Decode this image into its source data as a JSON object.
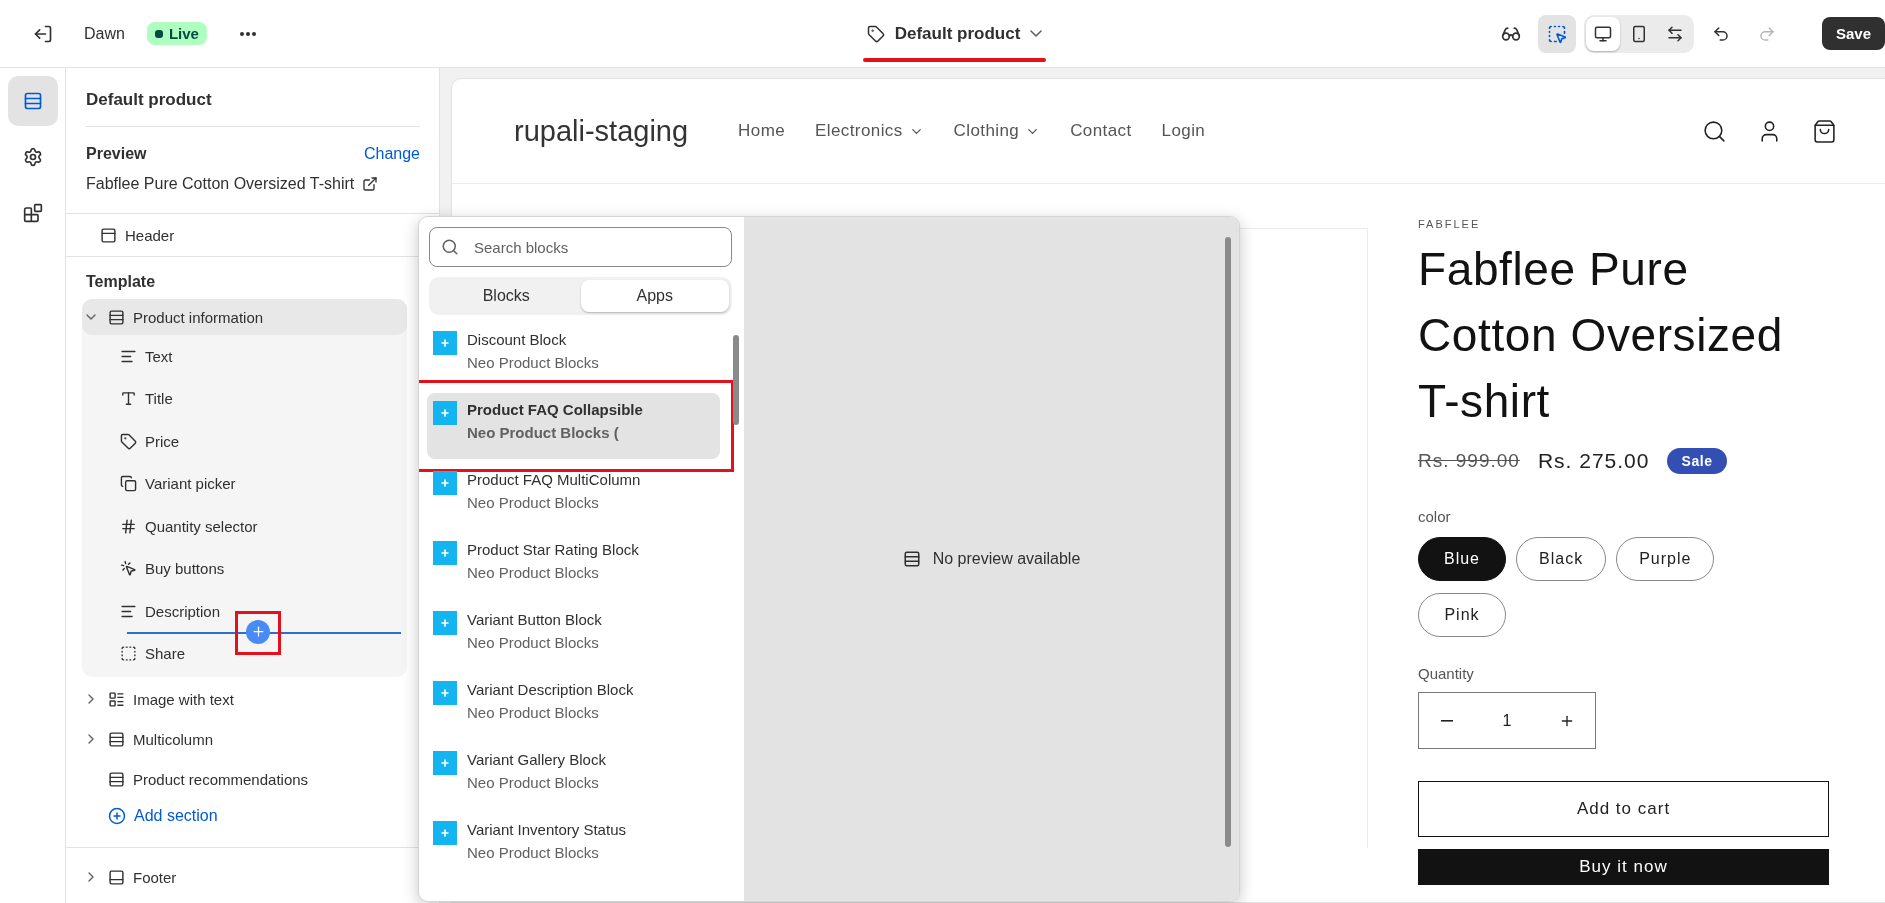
{
  "topbar": {
    "theme_name": "Dawn",
    "status_badge": "Live",
    "template_selector": "Default product",
    "save_button": "Save",
    "tools": [
      {
        "kind": "inspector",
        "selected": true
      }
    ],
    "views": [
      {
        "kind": "desktop",
        "selected": true
      },
      {
        "kind": "mobile",
        "selected": false
      },
      {
        "kind": "fullwidth",
        "selected": false
      }
    ]
  },
  "rail": [
    {
      "kind": "sections",
      "selected": true
    },
    {
      "kind": "settings",
      "selected": false
    },
    {
      "kind": "apps",
      "selected": false
    }
  ],
  "sidebar": {
    "title": "Default product",
    "preview_label": "Preview",
    "change_link": "Change",
    "preview_product": "Fabflee Pure Cotton Oversized T-shirt",
    "header_section": "Header",
    "template_heading": "Template",
    "sections": [
      {
        "label": "Product information",
        "kind": "section",
        "expanded": true,
        "selected": true,
        "children": [
          {
            "label": "Text",
            "kind": "text",
            "insert_marker": false
          },
          {
            "label": "Title",
            "kind": "title",
            "insert_marker": false
          },
          {
            "label": "Price",
            "kind": "price",
            "insert_marker": false
          },
          {
            "label": "Variant picker",
            "kind": "variant",
            "insert_marker": false
          },
          {
            "label": "Quantity selector",
            "kind": "quantity",
            "insert_marker": false
          },
          {
            "label": "Buy buttons",
            "kind": "buy",
            "insert_marker": false
          },
          {
            "label": "Description",
            "kind": "text",
            "insert_marker": true
          },
          {
            "label": "Share",
            "kind": "share",
            "insert_marker": false
          }
        ]
      },
      {
        "label": "Image with text",
        "kind": "imagetext",
        "expanded": false,
        "selected": false
      },
      {
        "label": "Multicolumn",
        "kind": "section",
        "expanded": false,
        "selected": false
      },
      {
        "label": "Product recommendations",
        "kind": "section",
        "selected": false
      }
    ],
    "add_section": "Add section",
    "footer": {
      "label": "Footer",
      "expanded": false
    }
  },
  "block_picker": {
    "search_placeholder": "Search blocks",
    "tabs": [
      {
        "label": "Blocks",
        "selected": false
      },
      {
        "label": "Apps",
        "selected": true
      }
    ],
    "blocks": [
      {
        "name": "Discount Block",
        "app": "Neo Product Blocks",
        "selected": false
      },
      {
        "name": "Product FAQ Collapsible",
        "app": "Neo Product Blocks (",
        "selected": true
      },
      {
        "name": "Product FAQ MultiColumn",
        "app": "Neo Product Blocks",
        "selected": false
      },
      {
        "name": "Product Star Rating Block",
        "app": "Neo Product Blocks",
        "selected": false
      },
      {
        "name": "Variant Button Block",
        "app": "Neo Product Blocks",
        "selected": false
      },
      {
        "name": "Variant Description Block",
        "app": "Neo Product Blocks",
        "selected": false
      },
      {
        "name": "Variant Gallery Block",
        "app": "Neo Product Blocks",
        "selected": false
      },
      {
        "name": "Variant Inventory Status",
        "app": "Neo Product Blocks",
        "selected": false
      }
    ],
    "preview_message": "No preview available"
  },
  "storefront": {
    "logo": "rupali-staging",
    "nav": [
      {
        "label": "Home",
        "dropdown": false
      },
      {
        "label": "Electronics",
        "dropdown": true
      },
      {
        "label": "Clothing",
        "dropdown": true
      },
      {
        "label": "Contact",
        "dropdown": false
      },
      {
        "label": "Login",
        "dropdown": false
      }
    ],
    "vendor": "FABFLEE",
    "title": "Fabflee Pure Cotton Oversized T-shirt",
    "compare_price": "Rs. 999.00",
    "price": "Rs. 275.00",
    "sale_badge": "Sale",
    "option_label": "color",
    "options": [
      {
        "label": "Blue",
        "selected": true
      },
      {
        "label": "Black",
        "selected": false
      },
      {
        "label": "Purple",
        "selected": false
      },
      {
        "label": "Pink",
        "selected": false
      }
    ],
    "quantity_label": "Quantity",
    "quantity": "1",
    "add_to_cart": "Add to cart",
    "buy_now": "Buy it now"
  }
}
